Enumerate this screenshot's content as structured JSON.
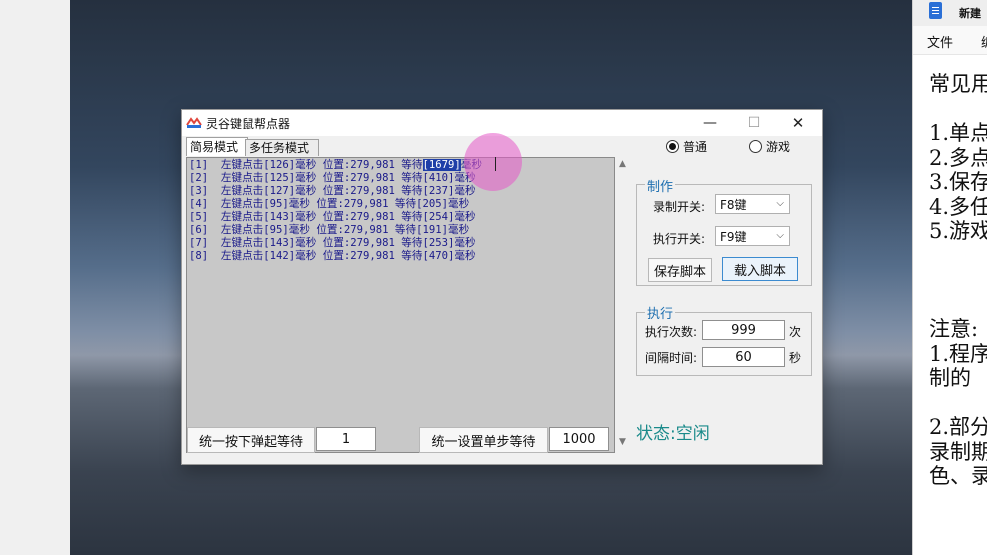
{
  "window": {
    "title": "灵谷键鼠帮点器",
    "min_glyph": "—",
    "max_glyph": "☐",
    "close_glyph": "✕"
  },
  "tabs": [
    {
      "label": "简易模式"
    },
    {
      "label": "多任务模式"
    }
  ],
  "script_lines": [
    {
      "pre": "[1]  左键点击[126]毫秒 位置:279,981 等待",
      "hl": "[1679]",
      "post": "毫秒"
    },
    {
      "pre": "[2]  左键点击[125]毫秒 位置:279,981 等待[410]毫秒",
      "hl": "",
      "post": ""
    },
    {
      "pre": "[3]  左键点击[127]毫秒 位置:279,981 等待[237]毫秒",
      "hl": "",
      "post": ""
    },
    {
      "pre": "[4]  左键点击[95]毫秒 位置:279,981 等待[205]毫秒",
      "hl": "",
      "post": ""
    },
    {
      "pre": "[5]  左键点击[143]毫秒 位置:279,981 等待[254]毫秒",
      "hl": "",
      "post": ""
    },
    {
      "pre": "[6]  左键点击[95]毫秒 位置:279,981 等待[191]毫秒",
      "hl": "",
      "post": ""
    },
    {
      "pre": "[7]  左键点击[143]毫秒 位置:279,981 等待[253]毫秒",
      "hl": "",
      "post": ""
    },
    {
      "pre": "[8]  左键点击[142]毫秒 位置:279,981 等待[470]毫秒",
      "hl": "",
      "post": ""
    }
  ],
  "bottom": {
    "press_release_label": "统一按下弹起等待",
    "press_release_value": "1",
    "step_wait_label": "统一设置单步等待",
    "step_wait_value": "1000"
  },
  "mode": {
    "normal_label": "普通",
    "game_label": "游戏",
    "selected": "普通"
  },
  "make": {
    "group_title": "制作",
    "record_label": "录制开关:",
    "record_value": "F8键",
    "exec_label": "执行开关:",
    "exec_value": "F9键",
    "save_button": "保存脚本",
    "load_button": "载入脚本"
  },
  "execute": {
    "group_title": "执行",
    "count_label": "执行次数:",
    "count_value": "999",
    "count_unit": "次",
    "interval_label": "间隔时间:",
    "interval_value": "60",
    "interval_unit": "秒"
  },
  "status_text": "状态:空闲",
  "notepad": {
    "tab_title": "新建",
    "menu": [
      "文件",
      "编"
    ],
    "text_lines": [
      "常见用",
      "",
      "1.单点",
      "2.多点",
      "3.保存",
      "4.多任",
      "5.游戏",
      "",
      "",
      "",
      "注意:",
      "1.程序",
      "制的",
      "",
      "2.部分",
      "录制期",
      "色、录"
    ]
  },
  "colors": {
    "status": "#1a8a8a",
    "group_title": "#1e6fb0",
    "script_text": "#1a1a8a",
    "highlight": "#1f3fa8"
  }
}
